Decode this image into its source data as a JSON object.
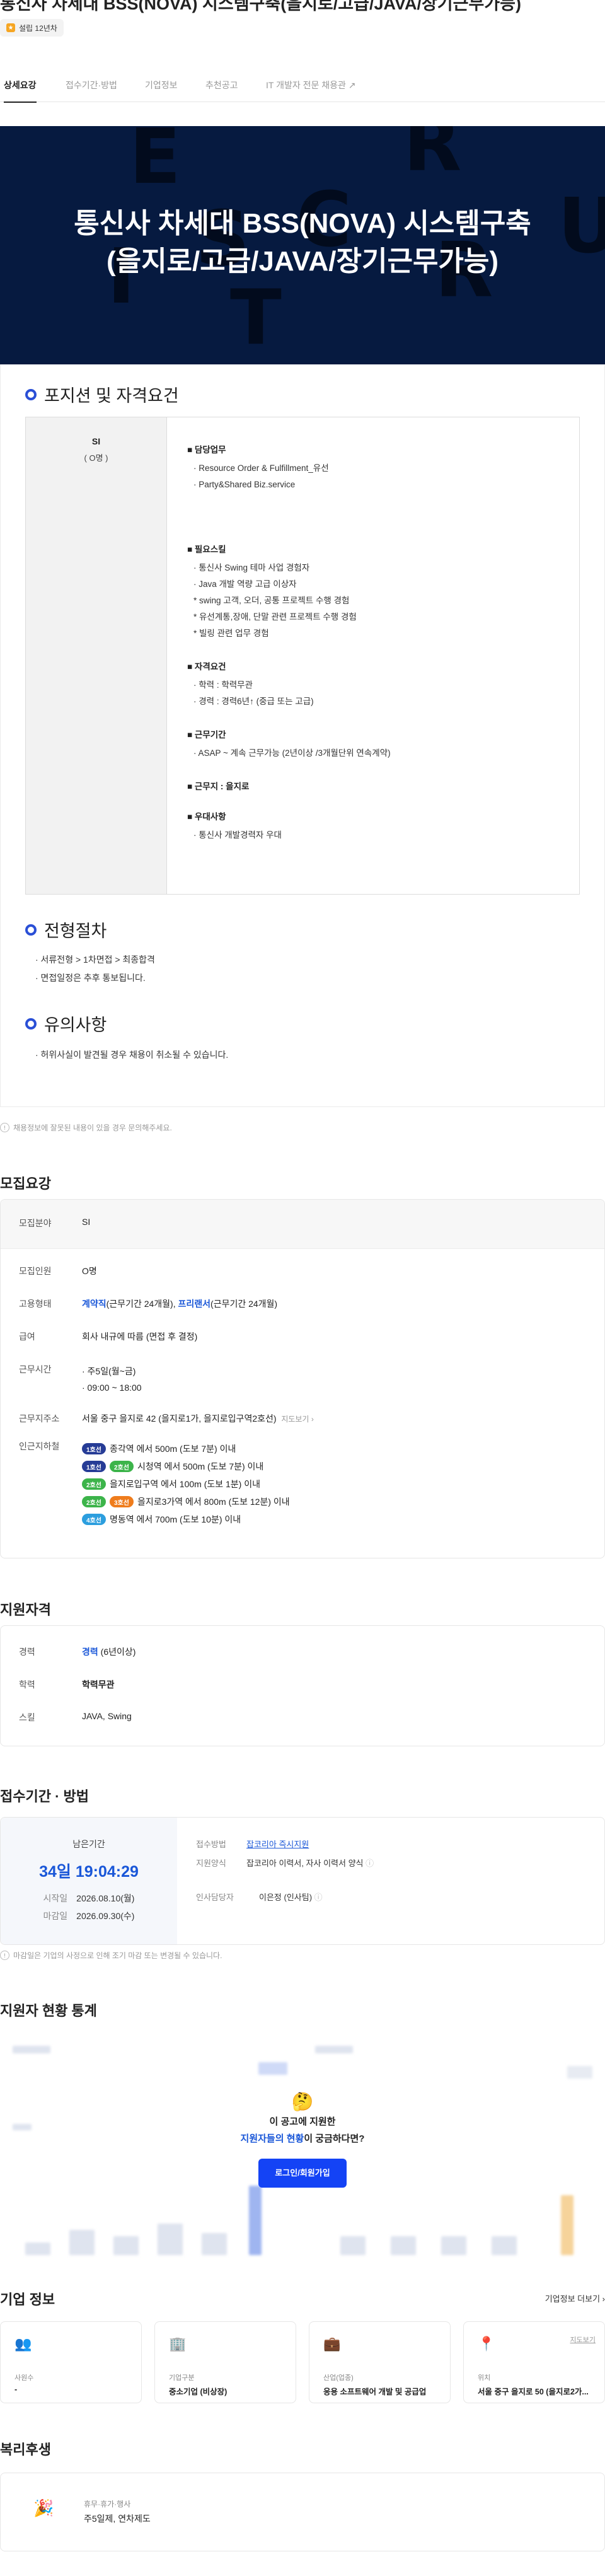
{
  "header": {
    "title": "통신사 차세대 BSS(NOVA) 시스템구축(을지로/고급/JAVA/장기근무가능)",
    "badge": "설립 12년차"
  },
  "tabs": [
    {
      "label": "상세요강"
    },
    {
      "label": "접수기간·방법"
    },
    {
      "label": "기업정보"
    },
    {
      "label": "추천공고"
    },
    {
      "label": "IT 개발자 전문 채용관"
    }
  ],
  "hero": {
    "line1": "통신사 차세대 BSS(NOVA) 시스템구축",
    "line2": "(을지로/고급/JAVA/장기근무가능)",
    "bg_letters": [
      "E",
      "R",
      "C",
      "U",
      "S",
      "R",
      "I",
      "T"
    ]
  },
  "position": {
    "heading": "포지션 및 자격요건",
    "left_title": "SI",
    "left_count": "( O명 )",
    "blocks": [
      {
        "h": "담당업무",
        "lines": [
          "· Resource Order & Fulfillment_유선",
          "· Party&Shared Biz.service"
        ]
      },
      {
        "h": "필요스킬",
        "lines": [
          "· 통신사 Swing 테마 사업 경험자",
          "· Java 개발 역량 고급 이상자",
          "* swing 고객, 오더, 공통 프로젝트 수행 경험",
          "* 유선계통,장애, 단말 관련 프로젝트 수행 경험",
          "* 빌링 관련 업무 경험"
        ]
      },
      {
        "h": "자격요건",
        "lines": [
          "· 학력 : 학력무관",
          "· 경력 : 경력6년↑ (중급 또는 고급)"
        ]
      },
      {
        "h": "근무기간",
        "lines": [
          "· ASAP ~  계속 근무가능 (2년이상 /3개월단위 연속계약)"
        ]
      },
      {
        "h": "근무지 : 을지로",
        "lines": []
      },
      {
        "h": "우대사항",
        "lines": [
          "· 통신사 개발경력자 우대"
        ]
      }
    ]
  },
  "process": {
    "heading": "전형절차",
    "lines": [
      "· 서류전형 > 1차면접 >  최종합격",
      "· 면접일정은 추후 통보됩니다."
    ]
  },
  "caution": {
    "heading": "유의사항",
    "lines": [
      "· 허위사실이 발견될 경우 채용이 취소될 수 있습니다."
    ]
  },
  "report_note": "채용정보에 잘못된 내용이 있을 경우 문의해주세요.",
  "recruit": {
    "heading": "모집요강",
    "field_k": "모집분야",
    "field_v": "SI",
    "rows": [
      {
        "k": "모집인원",
        "v": "O명"
      },
      {
        "k": "급여",
        "v": "회사 내규에 따름 (면접 후 결정)"
      }
    ],
    "emp_k": "고용형태",
    "emp_a": "계약직",
    "emp_a2": "(근무기간 24개월), ",
    "emp_b": "프리랜서",
    "emp_b2": "(근무기간 24개월)",
    "hours_k": "근무시간",
    "hours": [
      "· 주5일(월~금)",
      "· 09:00 ~ 18:00"
    ],
    "addr_k": "근무지주소",
    "addr_v": "서울 중구 을지로 42 (을지로1가, 을지로입구역2호선)",
    "map_link": "지도보기",
    "metro_k": "인근지하철",
    "metro": [
      {
        "badges": [
          {
            "t": "1호선",
            "c": "#263c96"
          }
        ],
        "text": "종각역 에서 500m (도보 7분) 이내"
      },
      {
        "badges": [
          {
            "t": "1호선",
            "c": "#263c96"
          },
          {
            "t": "2호선",
            "c": "#3cb44a"
          }
        ],
        "text": "시청역 에서 500m (도보 7분) 이내"
      },
      {
        "badges": [
          {
            "t": "2호선",
            "c": "#3cb44a"
          }
        ],
        "text": "을지로입구역 에서 100m (도보 1분) 이내"
      },
      {
        "badges": [
          {
            "t": "2호선",
            "c": "#3cb44a"
          },
          {
            "t": "3호선",
            "c": "#ef7c1c"
          }
        ],
        "text": "을지로3가역 에서 800m (도보 12분) 이내"
      },
      {
        "badges": [
          {
            "t": "4호선",
            "c": "#2c9ede"
          }
        ],
        "text": "명동역 에서 700m (도보 10분) 이내"
      }
    ]
  },
  "qualify": {
    "heading": "지원자격",
    "career_k": "경력",
    "career_v": "경력",
    "career_v2": " (6년이상)",
    "edu_k": "학력",
    "edu_v": "학력무관",
    "skill_k": "스킬",
    "skill_v": "JAVA, Swing"
  },
  "apply": {
    "heading": "접수기간 · 방법",
    "remain_label": "남은기간",
    "remain": "34일 19:04:29",
    "start_k": "시작일",
    "start_v": "2026.08.10(월)",
    "end_k": "마감일",
    "end_v": "2026.09.30(수)",
    "method_k": "접수방법",
    "method_v": "잡코리아 즉시지원",
    "form_k": "지원양식",
    "form_v": "잡코리아 이력서, 자사 이력서 양식",
    "manager_k": "인사담당자",
    "manager_v": "이은정 (인사팀)",
    "note": "마감일은 기업의 사정으로 인해 조기 마감 또는 변경될 수 있습니다."
  },
  "stats": {
    "heading": "지원자 현황 통계",
    "emoji": "🤔",
    "line1": "이 공고에 지원한",
    "line2a": "지원자들의 현황",
    "line2b": "이 궁금하다면?",
    "button": "로그인/회원가입"
  },
  "company": {
    "heading": "기업 정보",
    "more": "기업정보 더보기",
    "cards": [
      {
        "icon": "👥",
        "k": "사원수",
        "v": "-"
      },
      {
        "icon": "🏢",
        "k": "기업구분",
        "v": "중소기업 (비상장)"
      },
      {
        "icon": "💼",
        "k": "산업(업종)",
        "v": "응용 소프트웨어 개발 및 공급업"
      },
      {
        "icon": "📍",
        "k": "위치",
        "v": "서울 중구 을지로 50 (을지로2가...",
        "link": "지도보기"
      }
    ]
  },
  "welfare": {
    "heading": "복리후생",
    "icon": "🎉",
    "k": "휴무·휴가·행사",
    "v": "주5일제, 연차제도"
  },
  "colors": {
    "accent": "#1a57d8",
    "hero_bg": "#061a40",
    "cta": "#1443f5"
  }
}
